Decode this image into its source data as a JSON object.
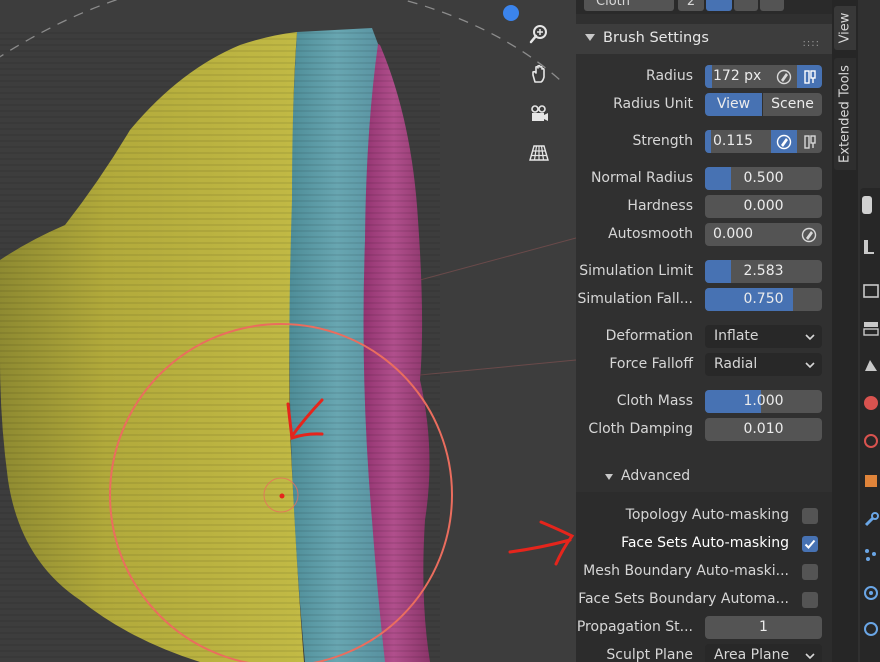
{
  "top_strip": {
    "cloth_label": "Cloth",
    "users_count": "2"
  },
  "brush_settings": {
    "title": "Brush Settings",
    "grip": "::::",
    "radius": {
      "label": "Radius",
      "value": "172 px",
      "fill": 0.1
    },
    "radius_unit": {
      "label": "Radius Unit",
      "options": [
        "View",
        "Scene"
      ],
      "selected": "View"
    },
    "strength": {
      "label": "Strength",
      "value": "0.115",
      "fill": 0.115
    },
    "normal_radius": {
      "label": "Normal Radius",
      "value": "0.500",
      "fill": 0.22
    },
    "hardness": {
      "label": "Hardness",
      "value": "0.000",
      "fill": 0
    },
    "autosmooth": {
      "label": "Autosmooth",
      "value": "0.000",
      "fill": 0
    },
    "simulation_limit": {
      "label": "Simulation Limit",
      "value": "2.583",
      "fill": 0.22
    },
    "simulation_falloff": {
      "label": "Simulation Fall...",
      "value": "0.750",
      "fill": 0.75
    },
    "deformation": {
      "label": "Deformation",
      "value": "Inflate"
    },
    "force_falloff": {
      "label": "Force Falloff",
      "value": "Radial"
    },
    "cloth_mass": {
      "label": "Cloth Mass",
      "value": "1.000",
      "fill": 0.5
    },
    "cloth_damping": {
      "label": "Cloth Damping",
      "value": "0.010",
      "fill": 0
    }
  },
  "advanced": {
    "title": "Advanced",
    "topology_automasking": {
      "label": "Topology Auto-masking",
      "checked": false
    },
    "face_sets_automasking": {
      "label": "Face Sets Auto-masking",
      "checked": true
    },
    "mesh_boundary_automasking": {
      "label": "Mesh Boundary Auto-maski...",
      "checked": false
    },
    "face_sets_boundary_automasking": {
      "label": "Face Sets Boundary Automa...",
      "checked": false
    },
    "propagation_steps": {
      "label": "Propagation St...",
      "value": "1"
    },
    "sculpt_plane": {
      "label": "Sculpt Plane",
      "value": "Area Plane"
    }
  },
  "sidebar_tabs": [
    "View",
    "Extended Tools"
  ],
  "colors": {
    "accent_blue": "#4772b3",
    "mesh_yellow": "#b4ac3c",
    "mesh_teal": "#5d9ba6",
    "mesh_magenta": "#a8447f",
    "brush_circle": "#ea6d5e",
    "annotation_red": "#e5251c"
  }
}
